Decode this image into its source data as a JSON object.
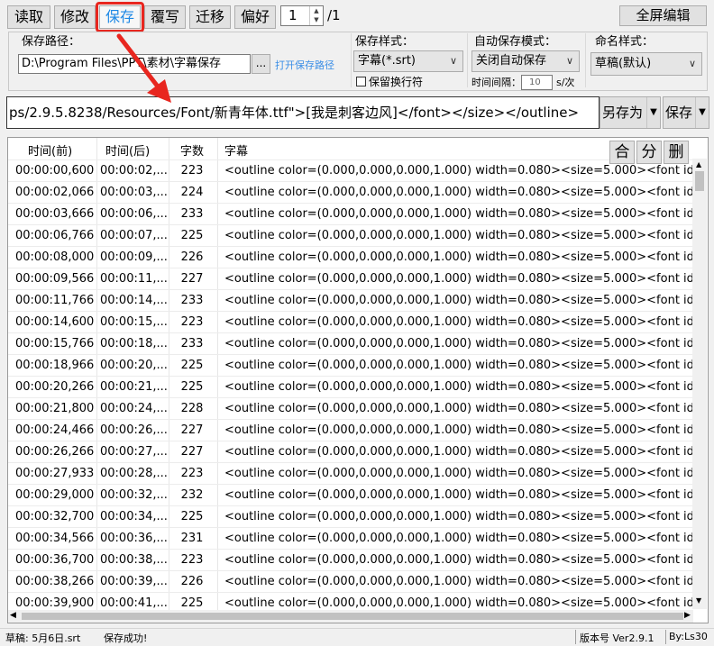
{
  "tabs": [
    "读取",
    "修改",
    "保存",
    "覆写",
    "迁移",
    "偏好"
  ],
  "page": {
    "current": "1",
    "total": "/1"
  },
  "fullscreen_label": "全屏编辑",
  "save_path": {
    "label": "保存路径：",
    "value": "D:\\Program Files\\PPT\\素材\\字幕保存",
    "browse_label": "...",
    "open_label": "打开保存路径"
  },
  "save_style": {
    "label": "保存样式：",
    "selected": "字幕(*.srt)",
    "keep_newline_label": "保留换行符"
  },
  "auto_save": {
    "label": "自动保存模式：",
    "selected": "关闭自动保存",
    "interval_label": "时间间隔：",
    "interval_value": "10",
    "interval_unit": "s/次"
  },
  "naming": {
    "label": "命名样式：",
    "selected": "草稿(默认)"
  },
  "text_line": "ps/2.9.5.8238/Resources/Font/新青年体.ttf\">[我是刺客边风]</font></size></outline>",
  "save_as_label": "另存为",
  "save_label": "保存",
  "table": {
    "columns": [
      "时间(前)",
      "时间(后)",
      "字数",
      "字幕"
    ],
    "rows": [
      [
        "00:00:00,600",
        "00:00:02,...",
        "223",
        "<outline color=(0.000,0.000,0.000,1.000) width=0.080><size=5.000><font id=\""
      ],
      [
        "00:00:02,066",
        "00:00:03,...",
        "224",
        "<outline color=(0.000,0.000,0.000,1.000) width=0.080><size=5.000><font id=\""
      ],
      [
        "00:00:03,666",
        "00:00:06,...",
        "233",
        "<outline color=(0.000,0.000,0.000,1.000) width=0.080><size=5.000><font id=\""
      ],
      [
        "00:00:06,766",
        "00:00:07,...",
        "225",
        "<outline color=(0.000,0.000,0.000,1.000) width=0.080><size=5.000><font id=\""
      ],
      [
        "00:00:08,000",
        "00:00:09,...",
        "226",
        "<outline color=(0.000,0.000,0.000,1.000) width=0.080><size=5.000><font id=\""
      ],
      [
        "00:00:09,566",
        "00:00:11,...",
        "227",
        "<outline color=(0.000,0.000,0.000,1.000) width=0.080><size=5.000><font id=\""
      ],
      [
        "00:00:11,766",
        "00:00:14,...",
        "233",
        "<outline color=(0.000,0.000,0.000,1.000) width=0.080><size=5.000><font id=\""
      ],
      [
        "00:00:14,600",
        "00:00:15,...",
        "223",
        "<outline color=(0.000,0.000,0.000,1.000) width=0.080><size=5.000><font id=\""
      ],
      [
        "00:00:15,766",
        "00:00:18,...",
        "233",
        "<outline color=(0.000,0.000,0.000,1.000) width=0.080><size=5.000><font id=\""
      ],
      [
        "00:00:18,966",
        "00:00:20,...",
        "225",
        "<outline color=(0.000,0.000,0.000,1.000) width=0.080><size=5.000><font id=\""
      ],
      [
        "00:00:20,266",
        "00:00:21,...",
        "225",
        "<outline color=(0.000,0.000,0.000,1.000) width=0.080><size=5.000><font id=\""
      ],
      [
        "00:00:21,800",
        "00:00:24,...",
        "228",
        "<outline color=(0.000,0.000,0.000,1.000) width=0.080><size=5.000><font id=\""
      ],
      [
        "00:00:24,466",
        "00:00:26,...",
        "227",
        "<outline color=(0.000,0.000,0.000,1.000) width=0.080><size=5.000><font id=\""
      ],
      [
        "00:00:26,266",
        "00:00:27,...",
        "227",
        "<outline color=(0.000,0.000,0.000,1.000) width=0.080><size=5.000><font id=\""
      ],
      [
        "00:00:27,933",
        "00:00:28,...",
        "223",
        "<outline color=(0.000,0.000,0.000,1.000) width=0.080><size=5.000><font id=\""
      ],
      [
        "00:00:29,000",
        "00:00:32,...",
        "232",
        "<outline color=(0.000,0.000,0.000,1.000) width=0.080><size=5.000><font id=\""
      ],
      [
        "00:00:32,700",
        "00:00:34,...",
        "225",
        "<outline color=(0.000,0.000,0.000,1.000) width=0.080><size=5.000><font id=\""
      ],
      [
        "00:00:34,566",
        "00:00:36,...",
        "231",
        "<outline color=(0.000,0.000,0.000,1.000) width=0.080><size=5.000><font id=\""
      ],
      [
        "00:00:36,700",
        "00:00:38,...",
        "223",
        "<outline color=(0.000,0.000,0.000,1.000) width=0.080><size=5.000><font id=\""
      ],
      [
        "00:00:38,266",
        "00:00:39,...",
        "226",
        "<outline color=(0.000,0.000,0.000,1.000) width=0.080><size=5.000><font id=\""
      ],
      [
        "00:00:39,900",
        "00:00:41,...",
        "225",
        "<outline color=(0.000,0.000,0.000,1.000) width=0.080><size=5.000><font id=\""
      ]
    ]
  },
  "grid_buttons": [
    "合",
    "分",
    "删"
  ],
  "status": {
    "draft": "草稿: 5月6日.srt",
    "message": "保存成功!",
    "version": "版本号 Ver2.9.1",
    "author": "By:Ls30"
  },
  "colors": {
    "accent": "#1e88e5",
    "highlight": "#e8261f",
    "link": "#3a8ee6"
  }
}
